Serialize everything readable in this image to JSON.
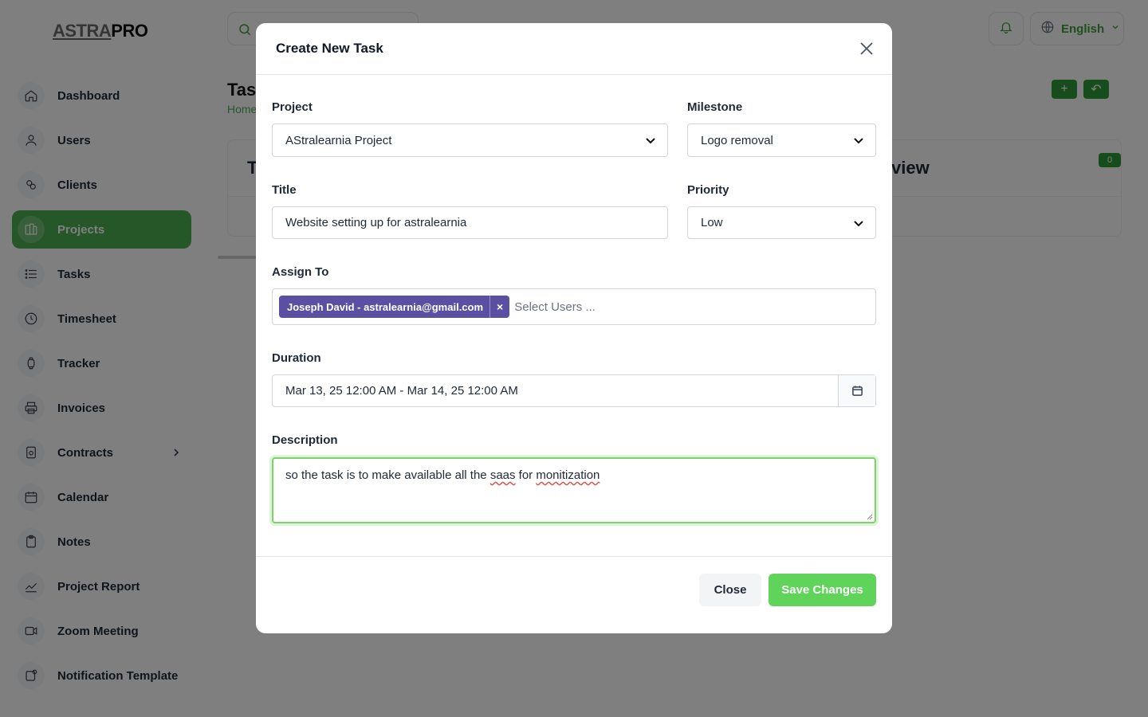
{
  "app": {
    "logo_part1": "ASTRA",
    "logo_part2": "PRO",
    "language": "English",
    "page_title": "Task",
    "breadcrumb": "Home",
    "card_title_left": "T",
    "card_title_right": "view",
    "card_badge": "0"
  },
  "sidebar": {
    "items": [
      {
        "label": "Dashboard",
        "icon": "home-icon"
      },
      {
        "label": "Users",
        "icon": "user-icon"
      },
      {
        "label": "Clients",
        "icon": "clients-icon"
      },
      {
        "label": "Projects",
        "icon": "projects-icon",
        "active": true
      },
      {
        "label": "Tasks",
        "icon": "list-icon"
      },
      {
        "label": "Timesheet",
        "icon": "clock-icon"
      },
      {
        "label": "Tracker",
        "icon": "watch-icon"
      },
      {
        "label": "Invoices",
        "icon": "printer-icon"
      },
      {
        "label": "Contracts",
        "icon": "contract-icon"
      },
      {
        "label": "Calendar",
        "icon": "calendar-icon"
      },
      {
        "label": "Notes",
        "icon": "clipboard-icon"
      },
      {
        "label": "Project Report",
        "icon": "chart-icon"
      },
      {
        "label": "Zoom Meeting",
        "icon": "video-icon"
      },
      {
        "label": "Notification Template",
        "icon": "notification-icon"
      }
    ]
  },
  "modal": {
    "title": "Create New Task",
    "project": {
      "label": "Project",
      "value": "AStralearnia Project"
    },
    "milestone": {
      "label": "Milestone",
      "value": "Logo removal"
    },
    "title_field": {
      "label": "Title",
      "value": "Website setting up for astralearnia"
    },
    "priority": {
      "label": "Priority",
      "value": "Low"
    },
    "assign": {
      "label": "Assign To",
      "tag": "Joseph David - astralearnia@gmail.com",
      "tag_remove": "×",
      "placeholder": "Select Users ..."
    },
    "duration": {
      "label": "Duration",
      "value": "Mar 13, 25 12:00 AM - Mar 14, 25 12:00 AM"
    },
    "description": {
      "label": "Description",
      "text_a": "so the task is to make available all the ",
      "word_saas": "saas",
      "text_b": " for ",
      "word_monitization": "monitization"
    },
    "close_label": "Close",
    "save_label": "Save Changes"
  },
  "colors": {
    "accent": "#4caf50",
    "save_button": "#5fd35a",
    "tag": "#5b4fa3"
  }
}
